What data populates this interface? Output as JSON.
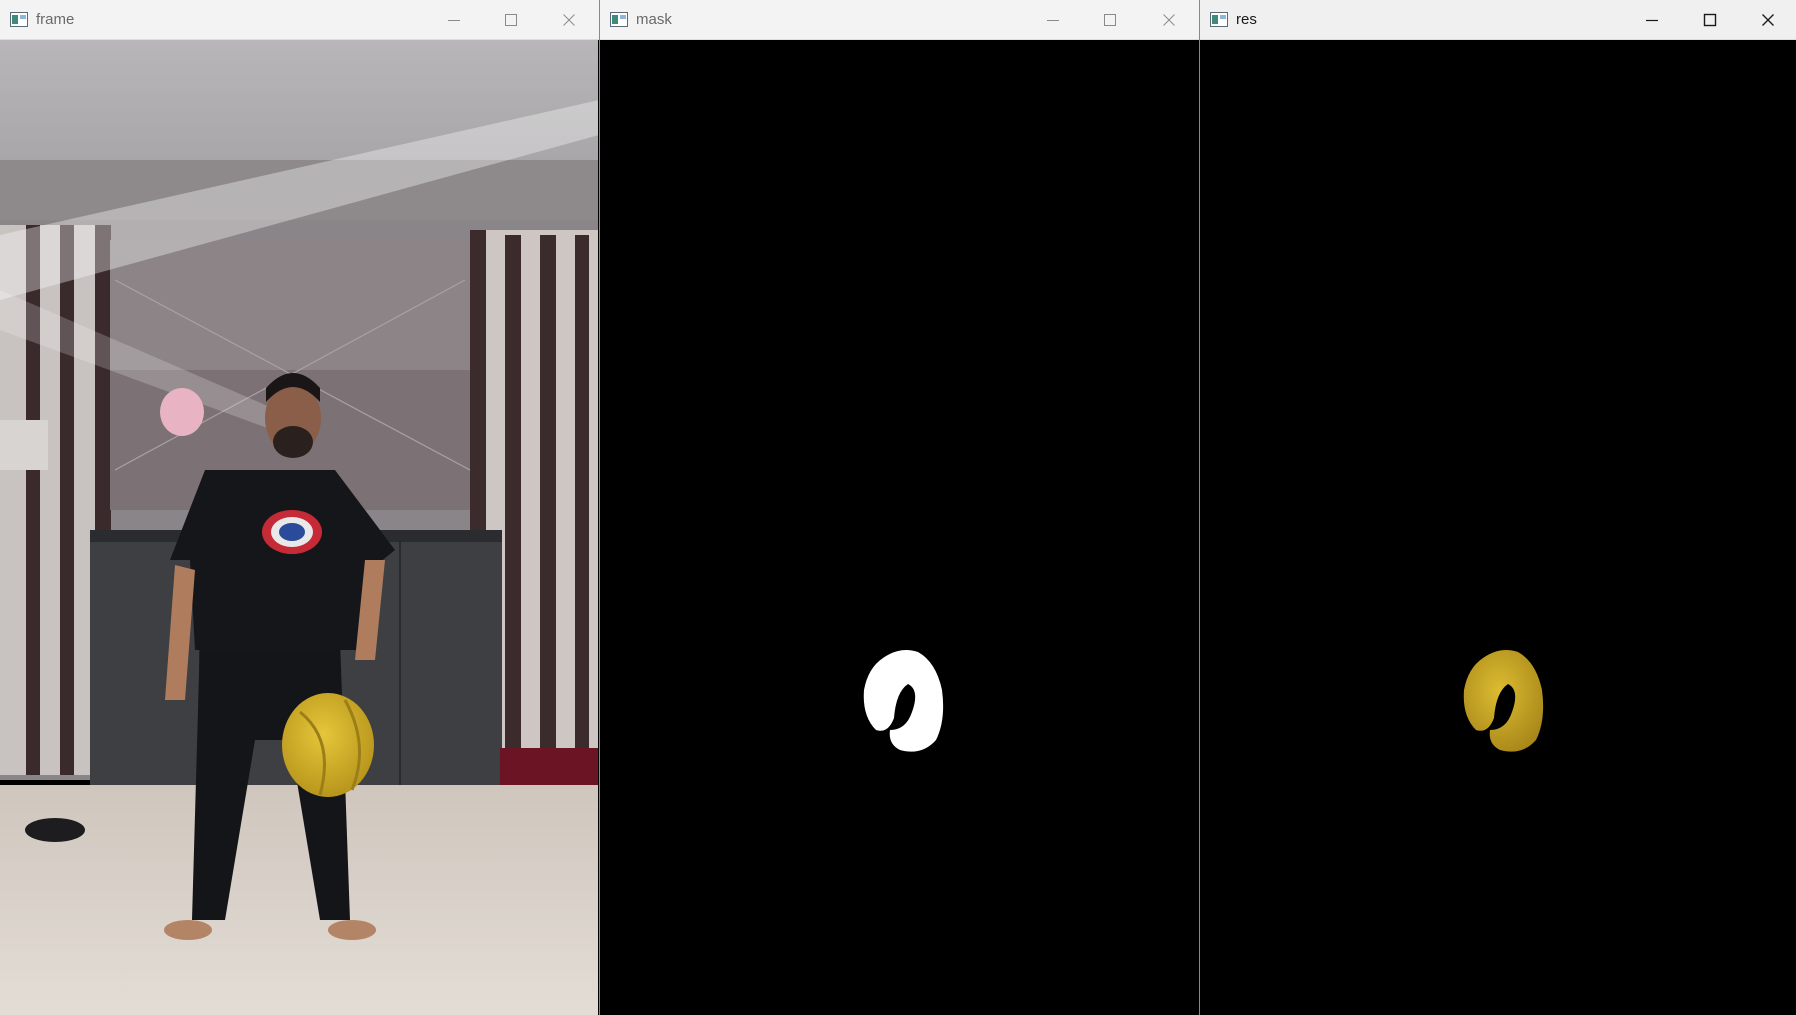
{
  "windows": [
    {
      "title": "frame",
      "active": false
    },
    {
      "title": "mask",
      "active": false
    },
    {
      "title": "res",
      "active": true
    }
  ],
  "controls": {
    "minimize": "minimize-icon",
    "maximize": "maximize-icon",
    "close": "close-icon"
  },
  "colors": {
    "titlebar": "#f3f3f3",
    "ball_yellow": "#d8b628",
    "mask_white": "#ffffff",
    "canvas_black": "#000000",
    "shirt_dark": "#15161a",
    "floor": "#d9d2cb",
    "balloon_pink": "#e8b4c4"
  }
}
